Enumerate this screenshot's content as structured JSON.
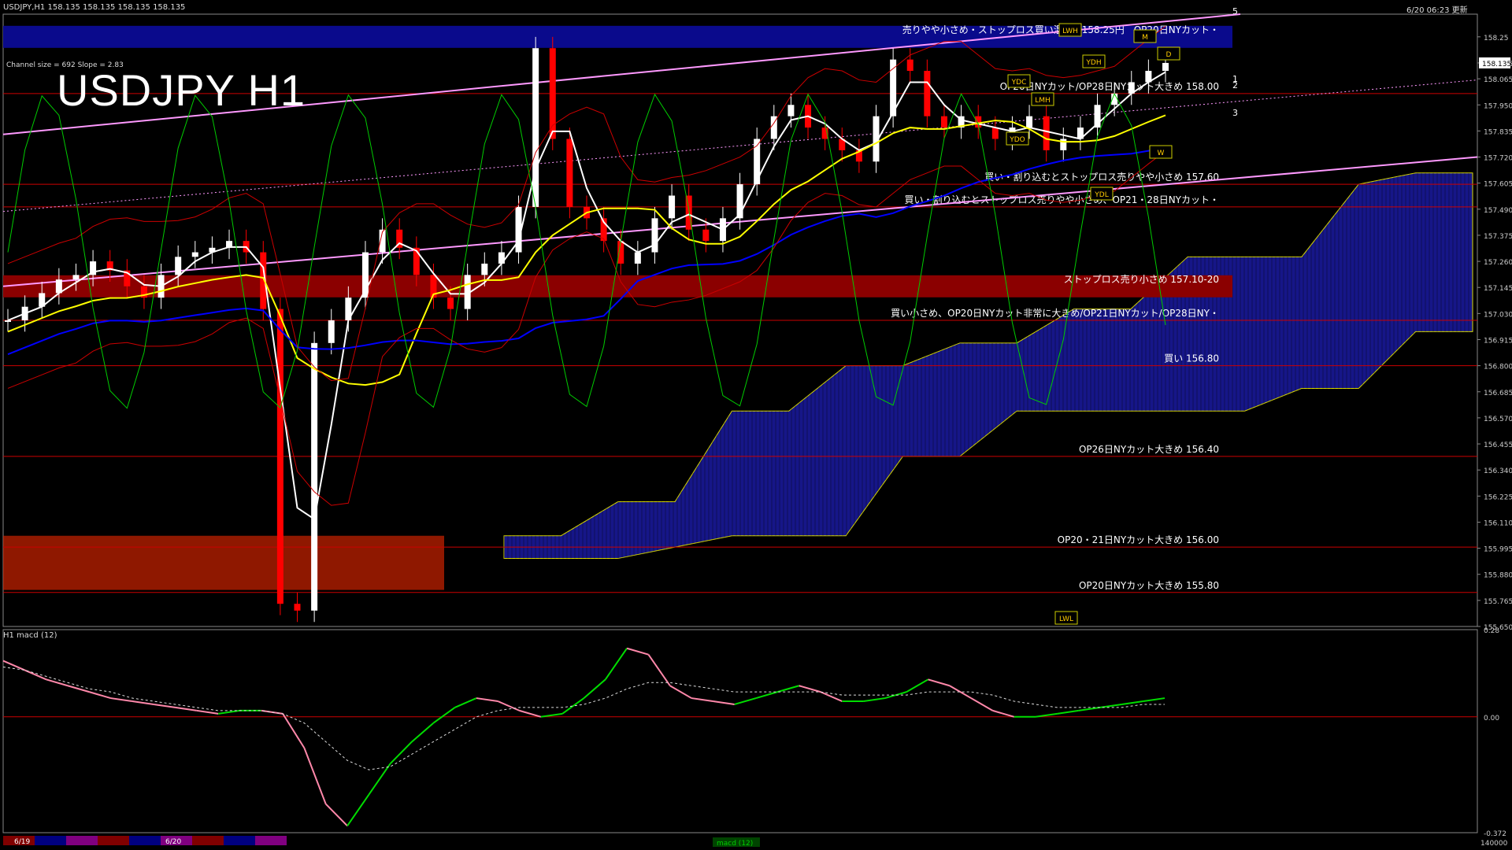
{
  "header": {
    "symbol_line": "USDJPY,H1  158.135 158.135 158.135 158.135",
    "datetime": "6/20 06:23 更新",
    "channel_info": "Channel size = 692 Slope = 2.83",
    "big_title": "USDJPY H1",
    "macd_label": "H1  macd (12)"
  },
  "chart_data": [
    {
      "type": "line",
      "title": "USDJPY H1",
      "ylim": [
        155.65,
        158.35
      ],
      "price_ticks": [
        "158.25",
        "158.135",
        "158.065",
        "157.950",
        "157.835",
        "157.720",
        "157.605",
        "157.490",
        "157.375",
        "157.260",
        "157.145",
        "157.030",
        "156.915",
        "156.800",
        "156.685",
        "156.570",
        "156.455",
        "156.340",
        "156.225",
        "156.110",
        "155.995",
        "155.880",
        "155.765",
        "155.650"
      ],
      "current_price": "158.135",
      "x_labels": [
        "6/19",
        "6/20"
      ],
      "close_series": [
        157.0,
        157.06,
        157.12,
        157.18,
        157.2,
        157.26,
        157.22,
        157.15,
        157.1,
        157.2,
        157.28,
        157.3,
        157.32,
        157.35,
        157.3,
        157.05,
        155.75,
        155.72,
        156.9,
        157.0,
        157.1,
        157.3,
        157.4,
        157.32,
        157.2,
        157.1,
        157.05,
        157.2,
        157.25,
        157.3,
        157.5,
        158.2,
        157.8,
        157.5,
        157.45,
        157.35,
        157.25,
        157.3,
        157.45,
        157.55,
        157.4,
        157.35,
        157.45,
        157.6,
        157.8,
        157.9,
        157.95,
        157.85,
        157.8,
        157.75,
        157.7,
        157.9,
        158.15,
        158.1,
        157.9,
        157.85,
        157.9,
        157.85,
        157.8,
        157.85,
        157.9,
        157.75,
        157.8,
        157.85,
        157.95,
        158.0,
        158.05,
        158.1,
        158.135
      ],
      "levels": [
        {
          "price": 158.25,
          "label": "売りやや小さめ・ストップロス買い混在　158.25円　OP20日NYカット・",
          "color": "#0a0a8c",
          "band": true
        },
        {
          "price": 158.0,
          "label": "OP20日NYカット/OP28日NYカット大きめ 158.00",
          "color": "#cc0000"
        },
        {
          "price": 157.6,
          "label": "買い・割り込むとストップロス売りやや小さめ 157.60",
          "color": "#cc0000"
        },
        {
          "price": 157.5,
          "label": "買い・割り込むとストップロス売りやや小さめ、OP21・28日NYカット・",
          "color": "#cc0000"
        },
        {
          "price": 157.15,
          "label": "ストップロス売り小さめ 157.10-20",
          "color": "#8b0000",
          "band": true
        },
        {
          "price": 157.0,
          "label": "買い小さめ、OP20日NYカット非常に大きめ/OP21日NYカット/OP28日NY・",
          "color": "#cc0000"
        },
        {
          "price": 156.8,
          "label": "買い 156.80",
          "color": "#cc0000"
        },
        {
          "price": 156.4,
          "label": "OP26日NYカット大きめ 156.40",
          "color": "#cc0000"
        },
        {
          "price": 156.0,
          "label": "OP20・21日NYカット大きめ 156.00",
          "color": "#cc0000"
        },
        {
          "price": 155.8,
          "label": "OP20日NYカット大きめ 155.80",
          "color": "#cc0000"
        }
      ],
      "markers": [
        "LWH",
        "YDH",
        "YDC",
        "YDO",
        "LMH",
        "YDL",
        "LWL",
        "D",
        "W",
        "M"
      ],
      "channel_numbers": [
        "1",
        "2",
        "3",
        "5"
      ],
      "colors": {
        "up": "#ffffff",
        "down": "#ff0000",
        "ma_fast": "#ffffff",
        "ma_mid": "#ffff00",
        "ma_slow": "#0000ff",
        "cloud": "#1a1aa0",
        "cloud_red": "#cc2200",
        "bollinger": "#cc0000",
        "oscillator": "#00cc00",
        "channel": "#ff99ff"
      }
    },
    {
      "type": "line",
      "title": "H1 macd (12)",
      "ylim": [
        -0.372,
        0.28
      ],
      "ticks": [
        "0.28",
        "0.00",
        "-0.372"
      ],
      "macd": [
        0.18,
        0.15,
        0.12,
        0.1,
        0.08,
        0.06,
        0.05,
        0.04,
        0.03,
        0.02,
        0.01,
        0.02,
        0.02,
        0.01,
        -0.1,
        -0.28,
        -0.35,
        -0.25,
        -0.15,
        -0.08,
        -0.02,
        0.03,
        0.06,
        0.05,
        0.02,
        0.0,
        0.01,
        0.06,
        0.12,
        0.22,
        0.2,
        0.1,
        0.06,
        0.05,
        0.04,
        0.06,
        0.08,
        0.1,
        0.08,
        0.05,
        0.05,
        0.06,
        0.08,
        0.12,
        0.1,
        0.06,
        0.02,
        0.0,
        0.0,
        0.01,
        0.02,
        0.03,
        0.04,
        0.05,
        0.06
      ],
      "signal": [
        0.16,
        0.15,
        0.13,
        0.11,
        0.09,
        0.08,
        0.06,
        0.05,
        0.04,
        0.03,
        0.02,
        0.02,
        0.02,
        0.01,
        -0.02,
        -0.08,
        -0.14,
        -0.17,
        -0.16,
        -0.12,
        -0.08,
        -0.04,
        0.0,
        0.02,
        0.03,
        0.03,
        0.03,
        0.04,
        0.06,
        0.09,
        0.11,
        0.11,
        0.1,
        0.09,
        0.08,
        0.08,
        0.08,
        0.08,
        0.08,
        0.07,
        0.07,
        0.07,
        0.07,
        0.08,
        0.08,
        0.08,
        0.07,
        0.05,
        0.04,
        0.03,
        0.03,
        0.03,
        0.03,
        0.04,
        0.04
      ]
    }
  ],
  "tabs": [
    "6/19",
    "6/20",
    "macd (12)"
  ],
  "bottom_right": "140000"
}
